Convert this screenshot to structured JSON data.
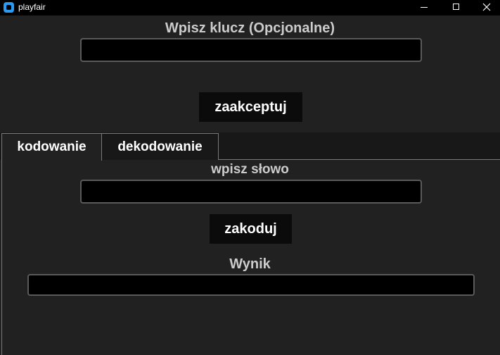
{
  "window": {
    "title": "playfair",
    "icons": {
      "app": "app-icon",
      "minimize": "minimize-icon",
      "maximize": "maximize-icon",
      "close": "close-icon"
    }
  },
  "key_section": {
    "label": "Wpisz klucz (Opcjonalne)",
    "input_value": "",
    "button_label": "zaakceptuj"
  },
  "tabs": [
    {
      "label": "kodowanie",
      "selected": true
    },
    {
      "label": "dekodowanie",
      "selected": false
    }
  ],
  "encode_panel": {
    "word_label": "wpisz słowo",
    "word_value": "",
    "button_label": "zakoduj",
    "result_label": "Wynik",
    "result_value": ""
  },
  "colors": {
    "background": "#212121",
    "titlebar": "#000000",
    "field_background": "#000000",
    "field_border": "#5a5a5a",
    "button_background": "#0b0b0b",
    "label_text": "#cccccc",
    "app_icon": "#2b9af3"
  }
}
